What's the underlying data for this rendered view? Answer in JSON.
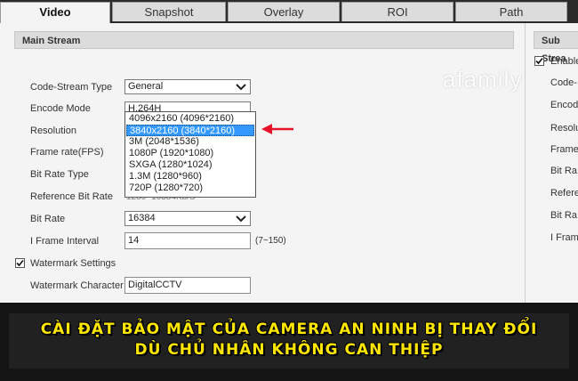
{
  "tabs": [
    {
      "label": "Video",
      "active": true
    },
    {
      "label": "Snapshot",
      "active": false
    },
    {
      "label": "Overlay",
      "active": false
    },
    {
      "label": "ROI",
      "active": false
    },
    {
      "label": "Path",
      "active": false
    }
  ],
  "main_stream": {
    "header": "Main Stream",
    "code_stream_type": {
      "label": "Code-Stream Type",
      "value": "General"
    },
    "encode_mode": {
      "label": "Encode Mode",
      "value": "H.264H"
    },
    "resolution": {
      "label": "Resolution"
    },
    "frame_rate": {
      "label": "Frame rate(FPS)"
    },
    "bit_rate_type": {
      "label": "Bit Rate Type"
    },
    "reference_bit_rate": {
      "label": "Reference Bit Rate",
      "value": "1280~16384Kb/S"
    },
    "bit_rate": {
      "label": "Bit Rate",
      "value": "16384"
    },
    "i_frame_interval": {
      "label": "I Frame Interval",
      "value": "14",
      "range": "(7~150)"
    },
    "watermark_settings": {
      "label": "Watermark Settings",
      "checked": true
    },
    "watermark_character": {
      "label": "Watermark Character",
      "value": "DigitalCCTV"
    }
  },
  "resolution_dropdown": {
    "options": [
      "4096x2160 (4096*2160)",
      "3840x2160 (3840*2160)",
      "3M (2048*1536)",
      "1080P (1920*1080)",
      "SXGA (1280*1024)",
      "1.3M (1280*960)",
      "720P (1280*720)"
    ],
    "selected_index": 1
  },
  "sub_stream": {
    "header": "Sub Strea",
    "enable": {
      "label": "Enable",
      "checked": true
    },
    "labels": [
      "Code-",
      "Encode",
      "Resolu",
      "Frame",
      "Bit Ra",
      "Refere",
      "Bit Ra",
      "I Fram"
    ]
  },
  "watermark_logo": "afamily",
  "caption": {
    "line1": "CÀI ĐẶT BẢO MẬT CỦA CAMERA AN NINH BỊ THAY ĐỔI",
    "line2": "DÙ CHỦ NHÂN KHÔNG CAN THIỆP"
  },
  "colors": {
    "selection": "#3399ff",
    "arrow": "#e8122a",
    "caption": "#ffe600"
  }
}
